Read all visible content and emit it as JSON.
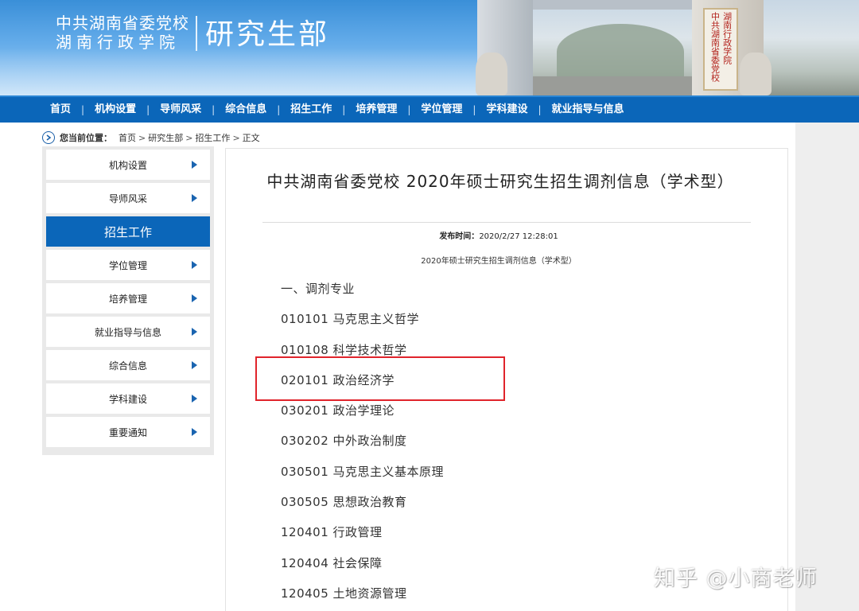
{
  "header": {
    "org_name_line1": "中共湖南省委党校",
    "org_name_line2": "湖南行政学院",
    "dept_name": "研究生部",
    "gate_plaque_col1": "中共湖南省委党校",
    "gate_plaque_col2": "湖南行政学院"
  },
  "nav": {
    "items": [
      "首页",
      "机构设置",
      "导师风采",
      "综合信息",
      "招生工作",
      "培养管理",
      "学位管理",
      "学科建设",
      "就业指导与信息"
    ],
    "separator": "|"
  },
  "breadcrumb": {
    "label": "您当前位置：",
    "items": [
      "首页",
      "研究生部",
      "招生工作",
      "正文"
    ],
    "separator": ">"
  },
  "sidebar": {
    "items": [
      {
        "label": "机构设置",
        "active": false
      },
      {
        "label": "导师风采",
        "active": false
      },
      {
        "label": "招生工作",
        "active": true
      },
      {
        "label": "学位管理",
        "active": false
      },
      {
        "label": "培养管理",
        "active": false
      },
      {
        "label": "就业指导与信息",
        "active": false
      },
      {
        "label": "综合信息",
        "active": false
      },
      {
        "label": "学科建设",
        "active": false
      },
      {
        "label": "重要通知",
        "active": false
      }
    ]
  },
  "article": {
    "title": "中共湖南省委党校 2020年硕士研究生招生调剂信息（学术型）",
    "pub_label": "发布时间：",
    "pub_time": "2020/2/27 12:28:01",
    "subtitle": "2020年硕士研究生招生调剂信息（学术型）",
    "lines": [
      "一、调剂专业",
      "010101 马克思主义哲学",
      "010108 科学技术哲学",
      "020101 政治经济学",
      "030201 政治学理论",
      "030202 中外政治制度",
      "030501 马克思主义基本原理",
      "030505 思想政治教育",
      "120401 行政管理",
      "120404 社会保障",
      "120405 土地资源管理"
    ]
  },
  "watermark": "知乎 @小商老师",
  "colors": {
    "nav_bg": "#0b66b9",
    "active_bg": "#0b66b9",
    "highlight": "#e0242b"
  }
}
